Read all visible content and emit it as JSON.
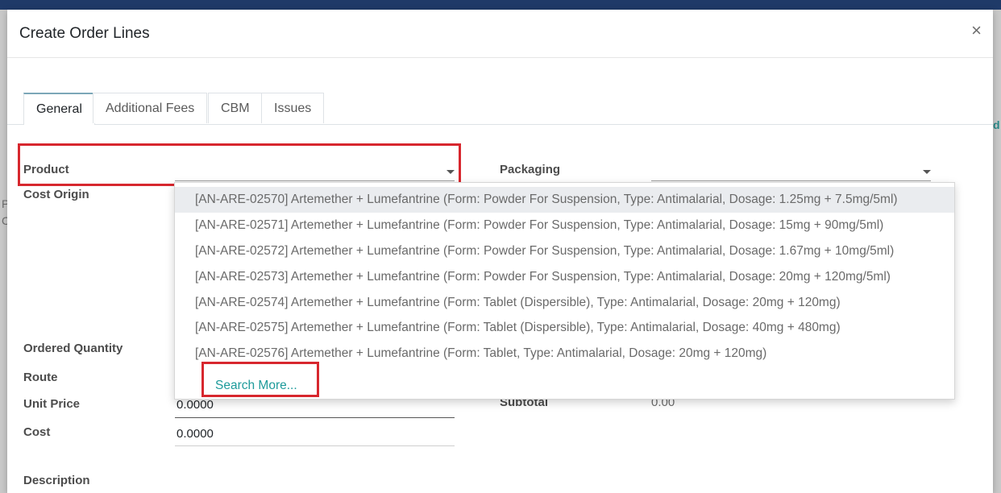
{
  "modal": {
    "title": "Create Order Lines",
    "close": "×"
  },
  "tabs": [
    "General",
    "Additional Fees",
    "CBM",
    "Issues"
  ],
  "fields": {
    "product_label": "Product",
    "packaging_label": "Packaging",
    "cost_origin_label": "Cost Origin",
    "ordered_quantity_label": "Ordered Quantity",
    "route_label": "Route",
    "unit_price_label": "Unit Price",
    "unit_price_value": "0.0000",
    "cost_label": "Cost",
    "cost_value": "0.0000",
    "subtotal_label": "Subtotal",
    "subtotal_value": "0.00",
    "description_label": "Description"
  },
  "dropdown": {
    "items": [
      "[AN-ARE-02570] Artemether + Lumefantrine (Form: Powder For Suspension, Type: Antimalarial, Dosage: 1.25mg + 7.5mg/5ml)",
      "[AN-ARE-02571] Artemether + Lumefantrine (Form: Powder For Suspension, Type: Antimalarial, Dosage: 15mg + 90mg/5ml)",
      "[AN-ARE-02572] Artemether + Lumefantrine (Form: Powder For Suspension, Type: Antimalarial, Dosage: 1.67mg + 10mg/5ml)",
      "[AN-ARE-02573] Artemether + Lumefantrine (Form: Powder For Suspension, Type: Antimalarial, Dosage: 20mg + 120mg/5ml)",
      "[AN-ARE-02574] Artemether + Lumefantrine (Form: Tablet (Dispersible), Type: Antimalarial, Dosage: 20mg + 120mg)",
      "[AN-ARE-02575] Artemether + Lumefantrine (Form: Tablet (Dispersible), Type: Antimalarial, Dosage: 40mg + 480mg)",
      "[AN-ARE-02576] Artemether + Lumefantrine (Form: Tablet, Type: Antimalarial, Dosage: 20mg + 120mg)"
    ],
    "search_more": "Search More..."
  },
  "background": {
    "right_hint": "d",
    "left_hint_1": "P",
    "left_hint_2": "C"
  },
  "colors": {
    "highlight": "#d7272e",
    "link": "#1e9b9b",
    "topbar": "#1f3a68"
  }
}
